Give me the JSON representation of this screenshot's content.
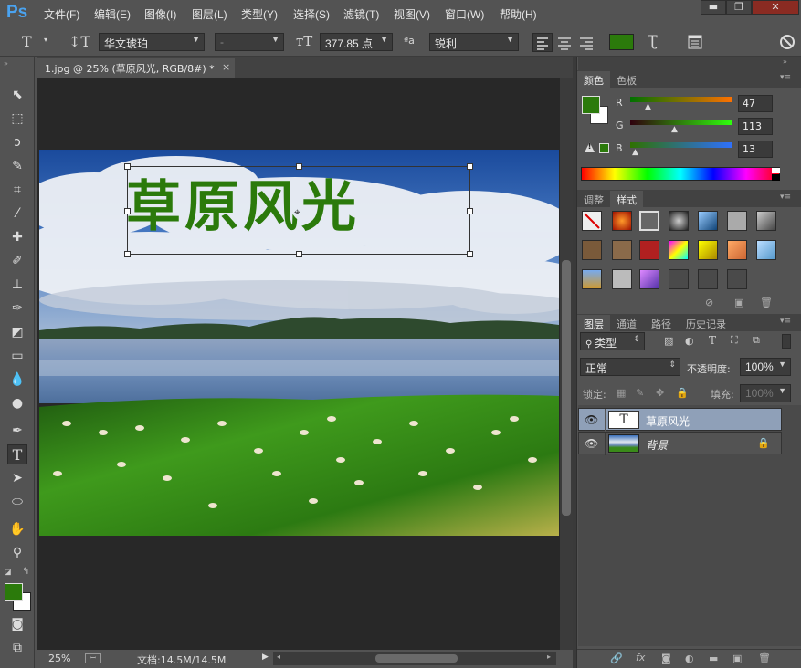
{
  "menubar": {
    "logo": "Ps",
    "items": [
      "文件(F)",
      "编辑(E)",
      "图像(I)",
      "图层(L)",
      "类型(Y)",
      "选择(S)",
      "滤镜(T)",
      "视图(V)",
      "窗口(W)",
      "帮助(H)"
    ],
    "window_controls": [
      "▬",
      "❐",
      "✕"
    ]
  },
  "options": {
    "font_family": "华文琥珀",
    "font_style": "-",
    "font_size": "377.85 点",
    "aa_label": "ªa",
    "antialias": "锐利",
    "text_color": "#2b7a0b"
  },
  "document": {
    "tab_title": "1.jpg @ 25% (草原风光, RGB/8#) *",
    "tab_close": "×",
    "canvas_text": "草原风光",
    "text_color": "#2b7a0b"
  },
  "status": {
    "zoom": "25%",
    "doc_info": "文档:14.5M/14.5M"
  },
  "color_panel": {
    "tabs": [
      "颜色",
      "色板"
    ],
    "r_label": "R",
    "g_label": "G",
    "b_label": "B",
    "r": 47,
    "g": 113,
    "b": 13,
    "warning": "!"
  },
  "styles_panel": {
    "tabs": [
      "调整",
      "样式"
    ]
  },
  "layers_panel": {
    "tabs": [
      "图层",
      "通道",
      "路径",
      "历史记录"
    ],
    "filter_label": "类型",
    "blend_mode": "正常",
    "opacity_label": "不透明度:",
    "opacity": "100%",
    "lock_label": "锁定:",
    "fill_label": "填充:",
    "fill": "100%",
    "layers": [
      {
        "name": "草原风光",
        "type": "text",
        "thumb": "T"
      },
      {
        "name": "背景",
        "type": "image",
        "lock": "🔒"
      }
    ],
    "bottom_icons": [
      "link",
      "fx",
      "mask",
      "adjust",
      "folder",
      "new",
      "trash"
    ],
    "fx_label": "fx"
  }
}
